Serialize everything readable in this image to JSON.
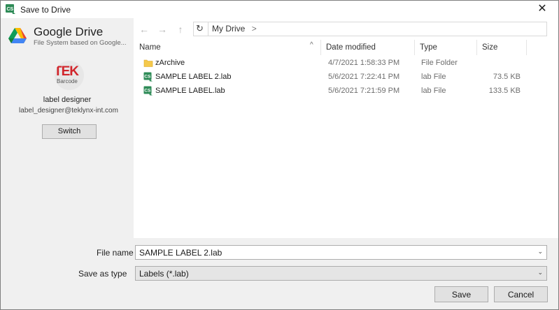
{
  "window": {
    "title": "Save to Drive",
    "app_icon": "cs-app-icon",
    "close_glyph": "✕"
  },
  "account": {
    "provider": "Google Drive",
    "provider_sub": "File System based on Google...",
    "avatar_text": "TEK",
    "avatar_sub": "Barcode",
    "user_name": "label designer",
    "user_email": "label_designer@teklynx-int.com",
    "switch_label": "Switch"
  },
  "nav": {
    "back": "←",
    "forward": "→",
    "up": "↑",
    "refresh": "↻"
  },
  "address": {
    "path": "My Drive",
    "chevron": ">"
  },
  "columns": {
    "name": "Name",
    "date": "Date modified",
    "type": "Type",
    "size": "Size",
    "sort_glyph": "^"
  },
  "files": [
    {
      "name": "zArchive",
      "date": "4/7/2021 1:58:33 PM",
      "type": "File Folder",
      "size": "",
      "icon": "folder-icon"
    },
    {
      "name": "SAMPLE LABEL 2.lab",
      "date": "5/6/2021 7:22:41 PM",
      "type": "lab File",
      "size": "73.5 KB",
      "icon": "lab-file-icon"
    },
    {
      "name": "SAMPLE LABEL.lab",
      "date": "5/6/2021 7:21:59 PM",
      "type": "lab File",
      "size": "133.5 KB",
      "icon": "lab-file-icon"
    }
  ],
  "form": {
    "file_name_label": "File name",
    "file_name_value": "SAMPLE LABEL 2.lab",
    "save_type_label": "Save as type",
    "save_type_value": "Labels (*.lab)",
    "chevron": "⌄"
  },
  "buttons": {
    "save": "Save",
    "cancel": "Cancel"
  },
  "colors": {
    "folder": "#f5c94c",
    "lab_icon": "#2e8b57",
    "avatar_red": "#d1252b"
  }
}
